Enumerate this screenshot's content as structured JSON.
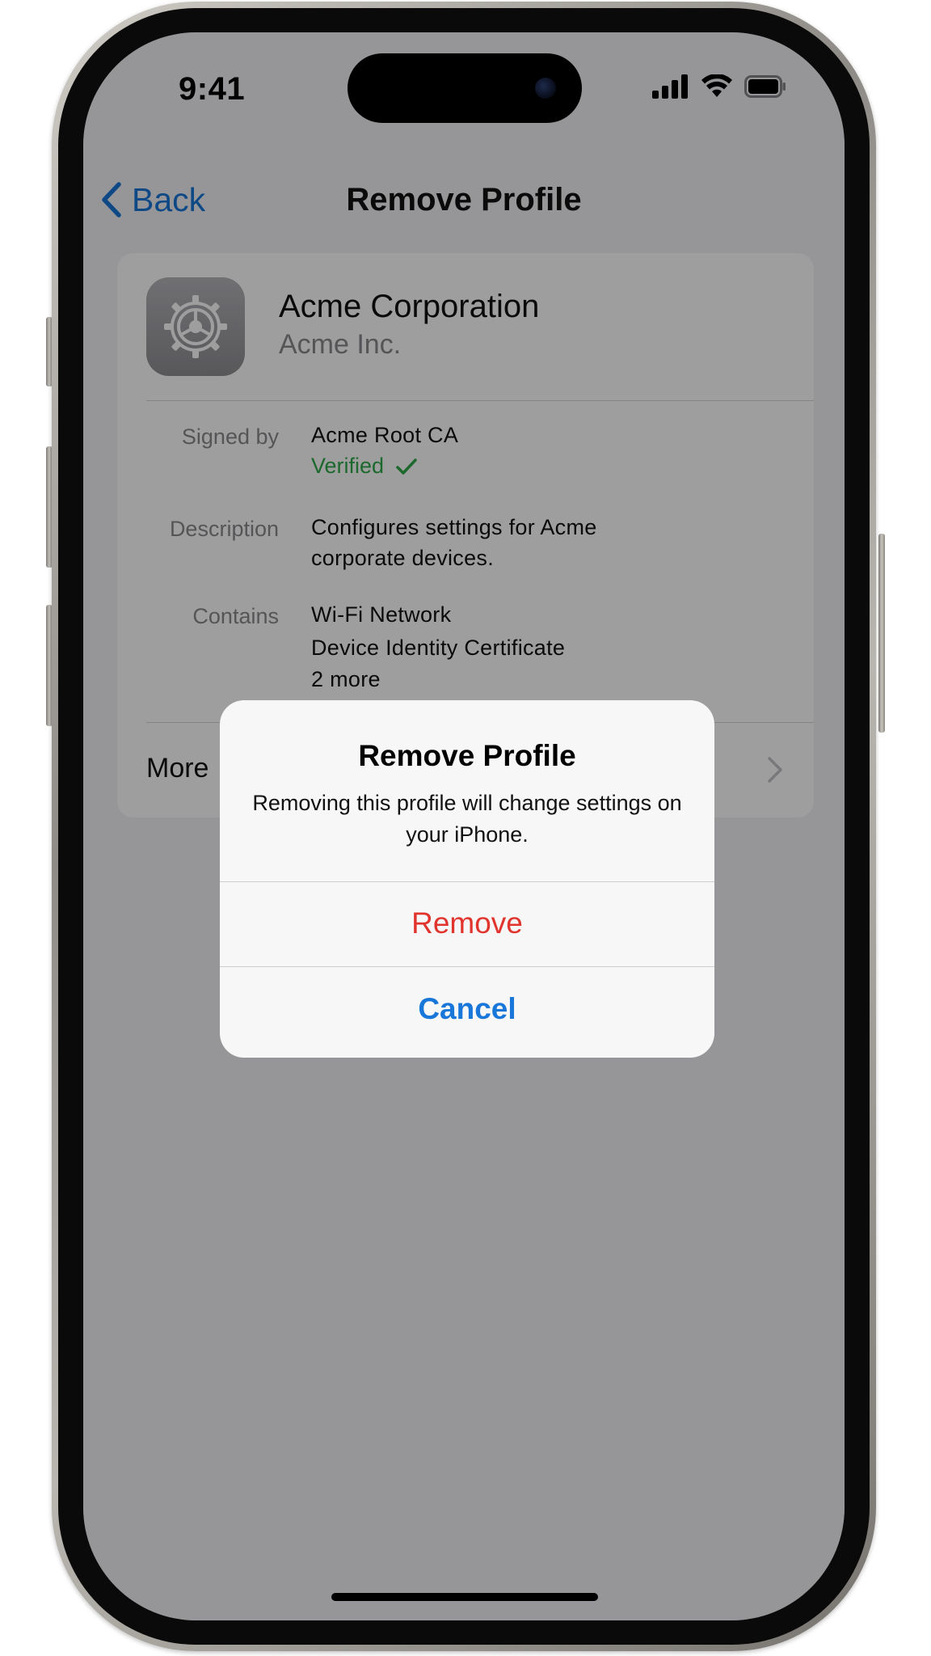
{
  "status_bar": {
    "time": "9:41",
    "icons": [
      "cellular-signal-icon",
      "wifi-icon",
      "battery-icon"
    ]
  },
  "nav": {
    "back_label": "Back",
    "title": "Remove Profile"
  },
  "profile": {
    "name": "Acme Corporation",
    "organization": "Acme Inc.",
    "icon": "settings-gear-icon",
    "signed_by_label": "Signed by",
    "signed_by_value": "Acme Root CA",
    "verified_label": "Verified",
    "description_label": "Description",
    "description_lines": [
      "Configures settings for Acme",
      "corporate devices."
    ],
    "contains_label": "Contains",
    "contains_items": [
      "Wi-Fi Network",
      "Device Identity Certificate",
      "2 more"
    ],
    "more_label": "More"
  },
  "alert": {
    "title": "Remove Profile",
    "message": "Removing this profile will change settings on your iPhone.",
    "remove_label": "Remove",
    "cancel_label": "Cancel"
  },
  "colors": {
    "accent_blue": "#1877d9",
    "destructive_red": "#e0342c",
    "verified_green": "#2ea84a"
  }
}
